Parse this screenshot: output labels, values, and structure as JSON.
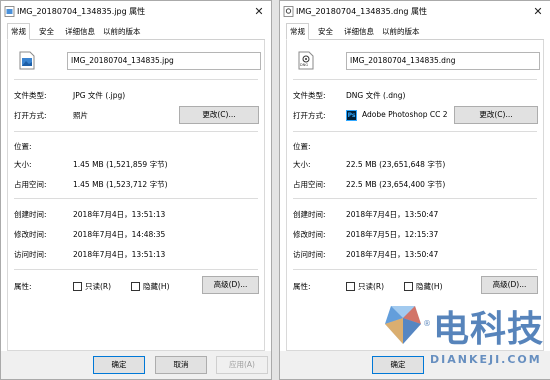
{
  "left": {
    "title": "IMG_20180704_134835.jpg 属性",
    "tabs": [
      "常规",
      "安全",
      "详细信息",
      "以前的版本"
    ],
    "file_name": "IMG_20180704_134835.jpg",
    "file_type_label": "文件类型:",
    "file_type": "JPG 文件 (.jpg)",
    "open_with_label": "打开方式:",
    "open_with": "照片",
    "change_button": "更改(C)...",
    "location_label": "位置:",
    "size_label": "大小:",
    "size": "1.45 MB (1,521,859 字节)",
    "size_on_disk_label": "占用空间:",
    "size_on_disk": "1.45 MB (1,523,712 字节)",
    "created_label": "创建时间:",
    "created": "2018年7月4日，13:51:13",
    "modified_label": "修改时间:",
    "modified": "2018年7月4日，14:48:35",
    "accessed_label": "访问时间:",
    "accessed": "2018年7月4日，13:51:13",
    "attributes_label": "属性:",
    "readonly_label": "只读(R)",
    "hidden_label": "隐藏(H)",
    "advanced_button": "高级(D)...",
    "ok_button": "确定",
    "cancel_button": "取消",
    "apply_button": "应用(A)"
  },
  "right": {
    "title": "IMG_20180704_134835.dng 属性",
    "tabs": [
      "常规",
      "安全",
      "详细信息",
      "以前的版本"
    ],
    "file_name": "IMG_20180704_134835.dng",
    "file_icon_text": "DNG",
    "file_type_label": "文件类型:",
    "file_type": "DNG 文件 (.dng)",
    "open_with_label": "打开方式:",
    "open_with_icon_text": "Ps",
    "open_with": "Adobe Photoshop CC 2",
    "change_button": "更改(C)...",
    "location_label": "位置:",
    "size_label": "大小:",
    "size": "22.5 MB (23,651,648 字节)",
    "size_on_disk_label": "占用空间:",
    "size_on_disk": "22.5 MB (23,654,400 字节)",
    "created_label": "创建时间:",
    "created": "2018年7月4日，13:50:47",
    "modified_label": "修改时间:",
    "modified": "2018年7月5日，12:15:37",
    "accessed_label": "访问时间:",
    "accessed": "2018年7月4日，13:50:47",
    "attributes_label": "属性:",
    "readonly_label": "只读(R)",
    "hidden_label": "隐藏(H)",
    "advanced_button": "高级(D)...",
    "ok_button": "确定"
  },
  "watermark": {
    "brand": "电科技",
    "domain": "DIANKEJI.COM",
    "registered": "®"
  },
  "colors": {
    "accent": "#0078d7",
    "footer_bg": "#f0f0f0",
    "watermark": "#3a6fb0"
  }
}
